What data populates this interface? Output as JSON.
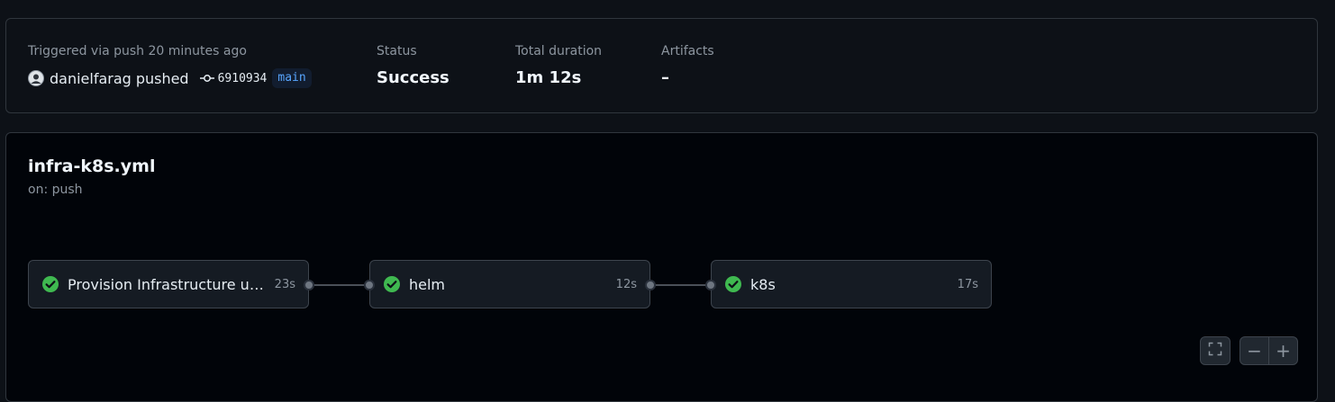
{
  "summary": {
    "trigger_label": "Triggered via push 20 minutes ago",
    "actor": "danielfarag",
    "action": "pushed",
    "commit_sha": "6910934",
    "branch": "main",
    "status_label": "Status",
    "status_value": "Success",
    "duration_label": "Total duration",
    "duration_value": "1m 12s",
    "artifacts_label": "Artifacts",
    "artifacts_value": "–"
  },
  "workflow": {
    "file": "infra-k8s.yml",
    "trigger": "on: push",
    "jobs": [
      {
        "name": "Provision Infrastructure us...",
        "duration": "23s",
        "status": "success",
        "icon": "check-circle-icon"
      },
      {
        "name": "helm",
        "duration": "12s",
        "status": "success",
        "icon": "check-circle-icon"
      },
      {
        "name": "k8s",
        "duration": "17s",
        "status": "success",
        "icon": "check-circle-icon"
      }
    ]
  },
  "controls": {
    "fullscreen_icon": "fullscreen-icon",
    "zoom_out_label": "−",
    "zoom_in_label": "+"
  },
  "colors": {
    "success": "#3fb950",
    "branch": "#58a6ff",
    "background": "#0d1117"
  }
}
